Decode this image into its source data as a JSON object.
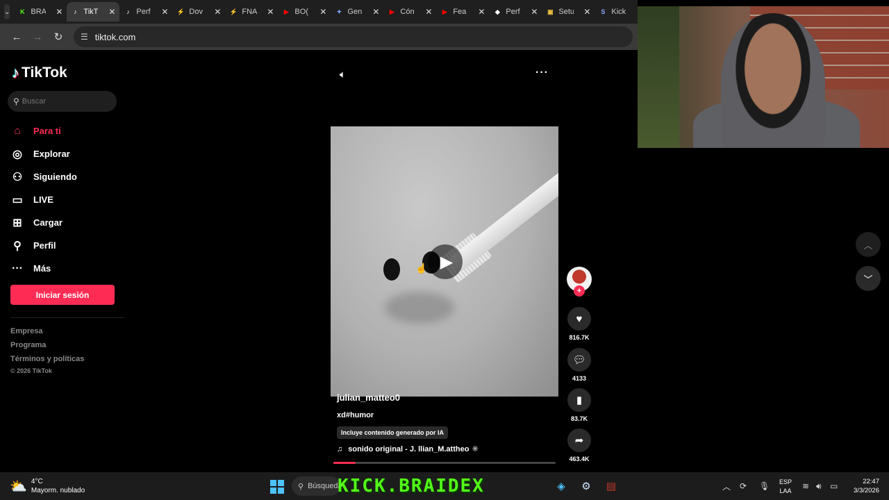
{
  "browser": {
    "tabs": [
      {
        "label": "BRA",
        "fav": "K",
        "color": "#53fc18"
      },
      {
        "label": "TikT",
        "fav": "♪",
        "color": "#ffffff",
        "active": true
      },
      {
        "label": "Perf",
        "fav": "♪",
        "color": "#ffffff"
      },
      {
        "label": "Dov",
        "fav": "⚡",
        "color": "#cfeeb0"
      },
      {
        "label": "FNA",
        "fav": "⚡",
        "color": "#cfeeb0"
      },
      {
        "label": "BO(",
        "fav": "▶",
        "color": "#ff0000"
      },
      {
        "label": "Gen",
        "fav": "✦",
        "color": "#7aa7ff"
      },
      {
        "label": "Cón",
        "fav": "▶",
        "color": "#ff0000"
      },
      {
        "label": "Fea",
        "fav": "▶",
        "color": "#ff0000"
      },
      {
        "label": "Perf",
        "fav": "◆",
        "color": "#ffffff"
      },
      {
        "label": "Setu",
        "fav": "▣",
        "color": "#f0c040"
      },
      {
        "label": "Kick",
        "fav": "S",
        "color": "#8aa8ff"
      }
    ],
    "url": "tiktok.com"
  },
  "sidebar": {
    "logo": "TikTok",
    "search_placeholder": "Buscar",
    "nav": [
      {
        "label": "Para ti",
        "icon": "home-icon",
        "glyph": "⌂",
        "active": true
      },
      {
        "label": "Explorar",
        "icon": "compass-icon",
        "glyph": "◎"
      },
      {
        "label": "Siguiendo",
        "icon": "following-icon",
        "glyph": "⚇"
      },
      {
        "label": "LIVE",
        "icon": "live-icon",
        "glyph": "▭"
      },
      {
        "label": "Cargar",
        "icon": "upload-icon",
        "glyph": "⊞"
      },
      {
        "label": "Perfil",
        "icon": "profile-icon",
        "glyph": "⚲"
      },
      {
        "label": "Más",
        "icon": "more-icon",
        "glyph": "···"
      }
    ],
    "login": "Iniciar sesión",
    "footer": [
      "Empresa",
      "Programa",
      "Términos y políticas"
    ],
    "copyright": "© 2026 TikTok"
  },
  "video": {
    "author": "julian_matteo0",
    "description": "xd#humor",
    "ai_label": "Incluye contenido generado por IA",
    "music": "sonido original - J. llian_M.attheo",
    "progress": 0.1,
    "likes": "816.7K",
    "comments": "4133",
    "saves": "83.7K",
    "shares": "463.4K"
  },
  "taskbar": {
    "temp": "4°C",
    "weather": "Mayorm. nublado",
    "search": "Búsqueda",
    "overlay": "KICK.BRAIDEX",
    "lang1": "ESP",
    "lang2": "LAA",
    "time": "22:47",
    "date": "3/3/2026"
  }
}
